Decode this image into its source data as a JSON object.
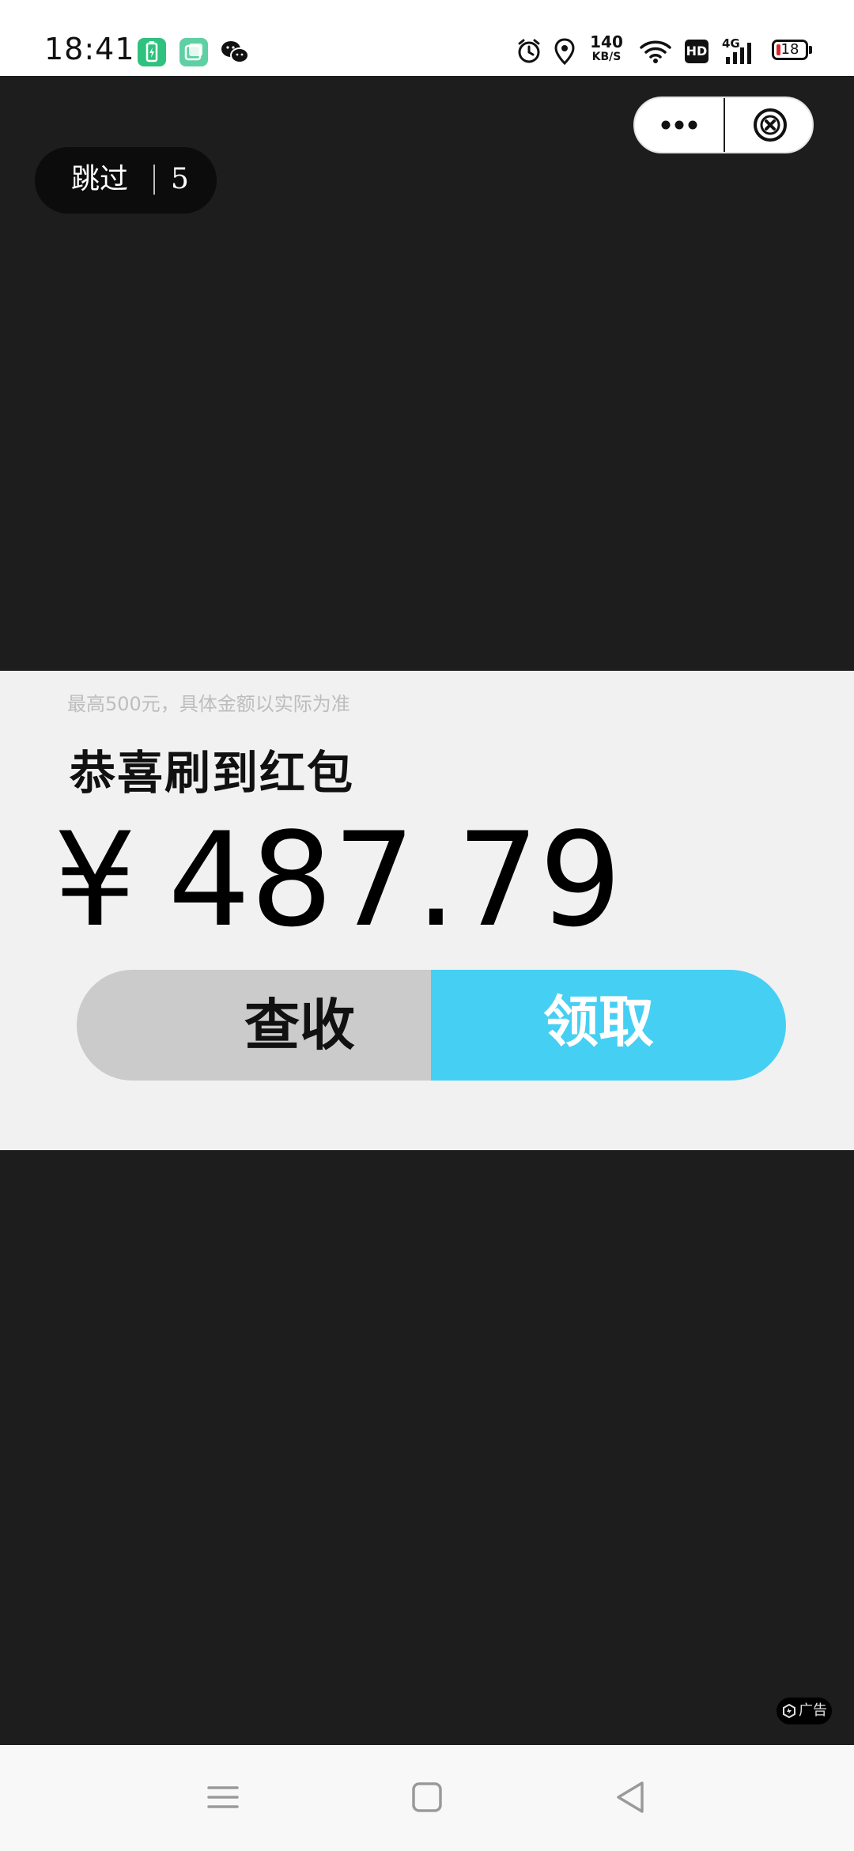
{
  "status_bar": {
    "time": "18:41",
    "net_speed_value": "140",
    "net_speed_unit": "KB/S",
    "hd_label": "HD",
    "network_type": "4G",
    "battery_level": "18"
  },
  "mini_program": {
    "more_icon": "more-dots-icon",
    "close_icon": "close-circle-icon"
  },
  "splash": {
    "skip_label": "跳过",
    "countdown": "5"
  },
  "red_packet": {
    "hint": "最高500元，具体金额以实际为准",
    "title": "恭喜刷到红包",
    "currency_symbol": "¥",
    "amount": "487.79",
    "check_button_label": "查收",
    "claim_button_label": "领取",
    "accent_color": "#45cff3"
  },
  "ad": {
    "label": "广告"
  },
  "nav_bar": {
    "menu_icon": "menu-icon",
    "home_icon": "home-square-icon",
    "back_icon": "back-triangle-icon"
  }
}
